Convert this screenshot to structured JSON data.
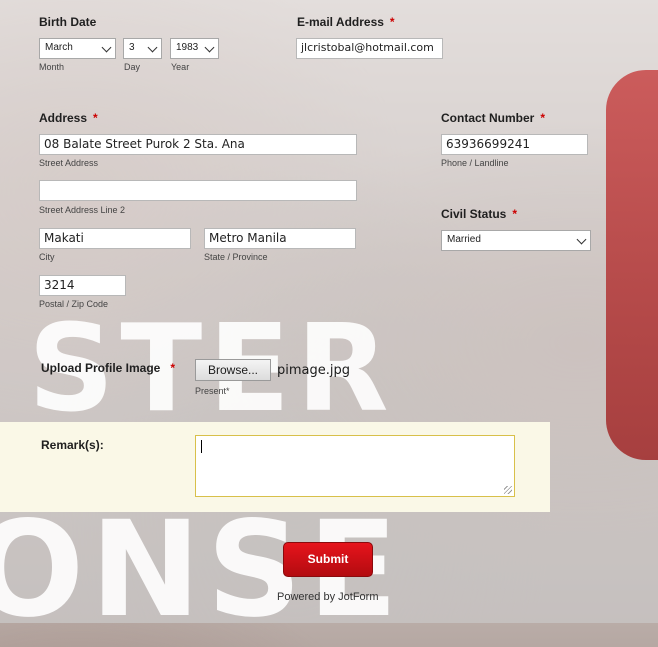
{
  "background": {
    "word_top": "STER",
    "word_bottom": "ONSE"
  },
  "birth_date": {
    "label": "Birth Date",
    "month": "March",
    "day": "3",
    "year": "1983",
    "month_sub": "Month",
    "day_sub": "Day",
    "year_sub": "Year"
  },
  "email": {
    "label": "E-mail Address",
    "required": "*",
    "value": "jlcristobal@hotmail.com"
  },
  "address": {
    "label": "Address",
    "required": "*",
    "street": "08 Balate Street Purok 2 Sta. Ana",
    "street_sub": "Street Address",
    "street2": "",
    "street2_sub": "Street Address Line 2",
    "city": "Makati",
    "city_sub": "City",
    "state": "Metro Manila",
    "state_sub": "State / Province",
    "postal": "3214",
    "postal_sub": "Postal / Zip Code"
  },
  "contact": {
    "label": "Contact Number",
    "required": "*",
    "value": "63936699241",
    "sub": "Phone / Landline"
  },
  "civil_status": {
    "label": "Civil Status",
    "required": "*",
    "value": "Married"
  },
  "upload": {
    "label": "Upload Profile Image",
    "required": "*",
    "browse_label": "Browse...",
    "filename": "pimage.jpg",
    "present_label": "Present*"
  },
  "remarks": {
    "label": "Remark(s):",
    "value": ""
  },
  "submit_label": "Submit",
  "powered_by": "Powered by JotForm",
  "colors": {
    "required": "#cc0000",
    "submit": "#d4101a",
    "remark_bg": "#fcfae8",
    "textarea_border": "#d8c04a"
  }
}
